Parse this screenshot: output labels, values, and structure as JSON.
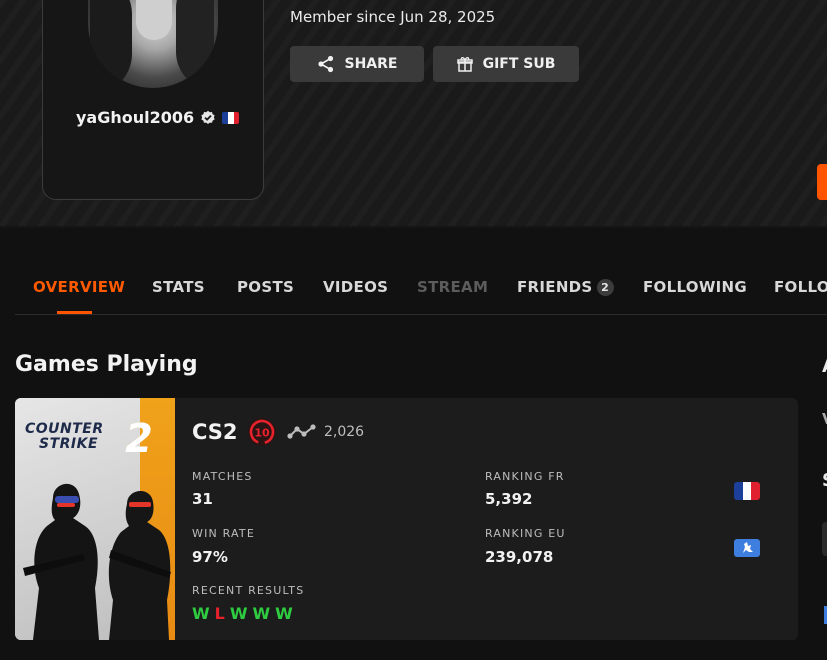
{
  "profile": {
    "username": "yaGhoul2006",
    "member_since": "Member since Jun 28, 2025",
    "country_flag_colors": [
      "#1c3f9a",
      "#ffffff",
      "#e1202f"
    ]
  },
  "actions": {
    "share_label": "SHARE",
    "gift_label": "GIFT SUB"
  },
  "tabs": [
    {
      "label": "OVERVIEW",
      "state": "active"
    },
    {
      "label": "STATS",
      "state": "normal"
    },
    {
      "label": "POSTS",
      "state": "normal"
    },
    {
      "label": "VIDEOS",
      "state": "normal"
    },
    {
      "label": "STREAM",
      "state": "disabled"
    },
    {
      "label": "FRIENDS",
      "state": "normal",
      "badge": "2"
    },
    {
      "label": "FOLLOWING",
      "state": "normal"
    },
    {
      "label": "FOLLO",
      "state": "normal"
    }
  ],
  "games_section": {
    "title": "Games Playing"
  },
  "game": {
    "cover_line1": "COUNTER",
    "cover_line2": "STRIKE",
    "cover_number": "2",
    "name": "CS2",
    "level": "10",
    "elo": "2,026",
    "stats": {
      "matches_label": "MATCHES",
      "matches_value": "31",
      "win_rate_label": "WIN RATE",
      "win_rate_value": "97%",
      "recent_label": "RECENT RESULTS",
      "recent_results": [
        "W",
        "L",
        "W",
        "W",
        "W"
      ],
      "ranking_country_label": "RANKING FR",
      "ranking_country_value": "5,392",
      "ranking_region_label": "RANKING EU",
      "ranking_region_value": "239,078"
    }
  },
  "right_edge": {
    "letter1": "A",
    "letter2": "V",
    "letter3": "S"
  },
  "colors": {
    "accent": "#ff5500",
    "win": "#2ecc40",
    "loss": "#e8222c",
    "level_ring": "#e8222c"
  },
  "icons": {
    "share": "share-icon",
    "gift": "gift-icon",
    "verified": "verified-icon",
    "elo": "elo-graph-icon"
  }
}
